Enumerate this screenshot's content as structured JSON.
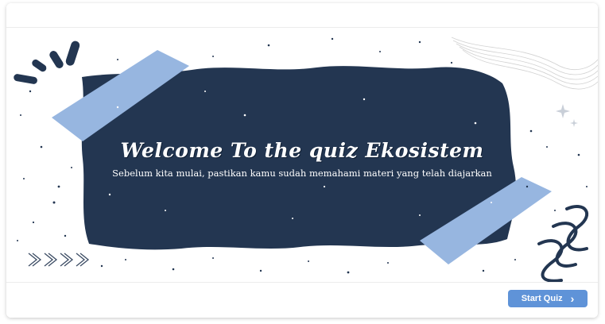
{
  "slide": {
    "title": "Welcome To the quiz Ekosistem",
    "subtitle": "Sebelum kita mulai, pastikan kamu sudah memahami materi yang telah diajarkan"
  },
  "footer": {
    "start_label": "Start Quiz",
    "start_icon": "chevron-right-icon"
  },
  "colors": {
    "navy": "#233651",
    "tape": "#97b6e0",
    "button": "#5f93d8"
  }
}
